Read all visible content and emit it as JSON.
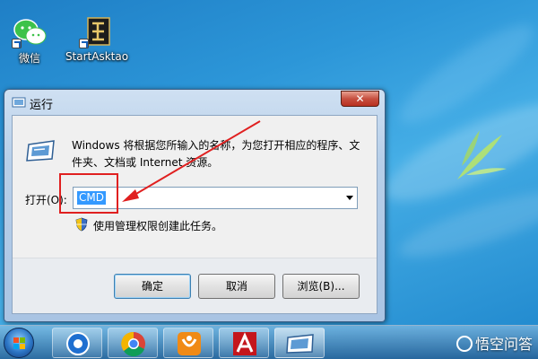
{
  "desktop": {
    "icons": [
      {
        "label": "微信"
      },
      {
        "label": "StartAsktao"
      }
    ]
  },
  "dialog": {
    "title": "运行",
    "close_glyph": "✕",
    "description": "Windows 将根据您所输入的名称，为您打开相应的程序、文件夹、文档或 Internet 资源。",
    "open_label": "打开(O):",
    "command_value": "CMD",
    "admin_note": "使用管理权限创建此任务。",
    "buttons": {
      "ok": "确定",
      "cancel": "取消",
      "browse": "浏览(B)..."
    }
  },
  "taskbar": {
    "items": [
      "media-player-icon",
      "chrome-icon",
      "uc-browser-icon",
      "acrobat-icon",
      "run-dialog-icon"
    ]
  },
  "watermark": {
    "text": "悟空问答"
  },
  "colors": {
    "annotation_red": "#e02020",
    "selection_blue": "#3399ff"
  }
}
